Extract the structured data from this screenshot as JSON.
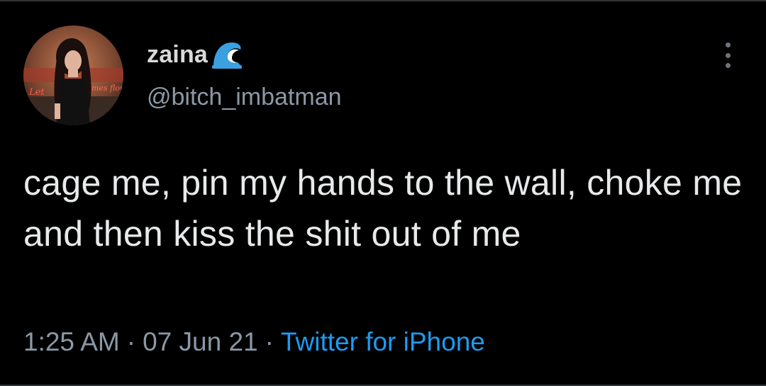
{
  "tweet": {
    "display_name": "zaina",
    "name_emoji": "wave-emoji",
    "handle": "@bitch_imbatman",
    "text": "cage me, pin my hands to the wall, choke me and then kiss the shit out of me",
    "time": "1:25 AM",
    "date": "07 Jun 21",
    "separator": "·",
    "source": "Twitter for iPhone"
  },
  "colors": {
    "background": "#000000",
    "text": "#e7e9ea",
    "secondary": "#8b98a5",
    "link": "#1d9bf0"
  },
  "icons": {
    "menu": "more-options-icon"
  }
}
